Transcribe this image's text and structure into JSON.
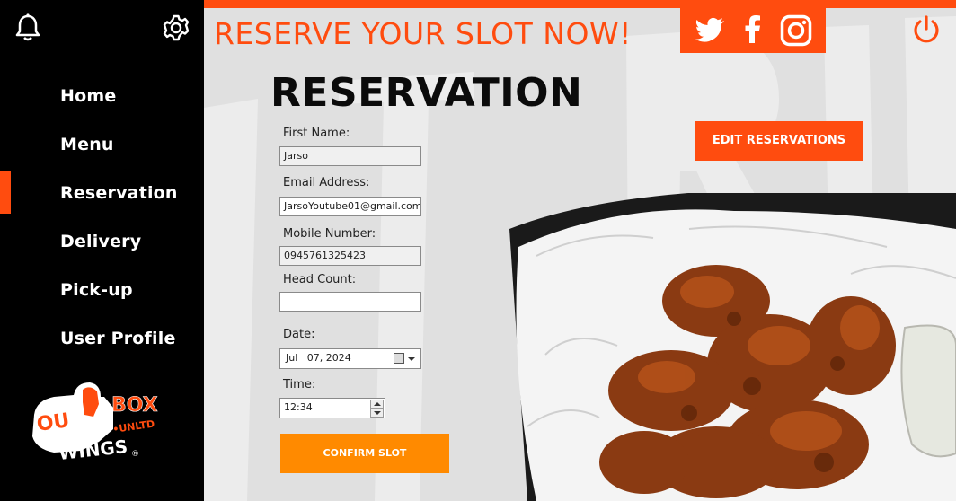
{
  "sidebar": {
    "items": [
      {
        "label": "Home"
      },
      {
        "label": "Menu"
      },
      {
        "label": "Reservation",
        "active": true
      },
      {
        "label": "Delivery"
      },
      {
        "label": "Pick-up"
      },
      {
        "label": "User Profile"
      }
    ],
    "logo": {
      "text_top": "OUT",
      "text_box": "BOX",
      "text_wings": "WINGS",
      "text_unltd": "UNLTD"
    }
  },
  "header": {
    "headline": "RESERVE YOUR SLOT NOW!",
    "social_icons": [
      "twitter-icon",
      "facebook-icon",
      "instagram-icon"
    ],
    "accent_color": "#ff4c0f"
  },
  "form": {
    "title": "RESERVATION",
    "edit_button": "EDIT RESERVATIONS",
    "first_name_label": "First Name:",
    "first_name_value": "Jarso",
    "email_label": "Email Address:",
    "email_value": "JarsoYoutube01@gmail.com",
    "mobile_label": "Mobile Number:",
    "mobile_value": "0945761325423",
    "head_count_label": "Head Count:",
    "head_count_value": "",
    "date_label": "Date:",
    "date_value": "Jul   07, 2024",
    "time_label": "Time:",
    "time_value": "12:34",
    "confirm_button": "CONFIRM SLOT",
    "confirm_color": "#ff8a00"
  }
}
